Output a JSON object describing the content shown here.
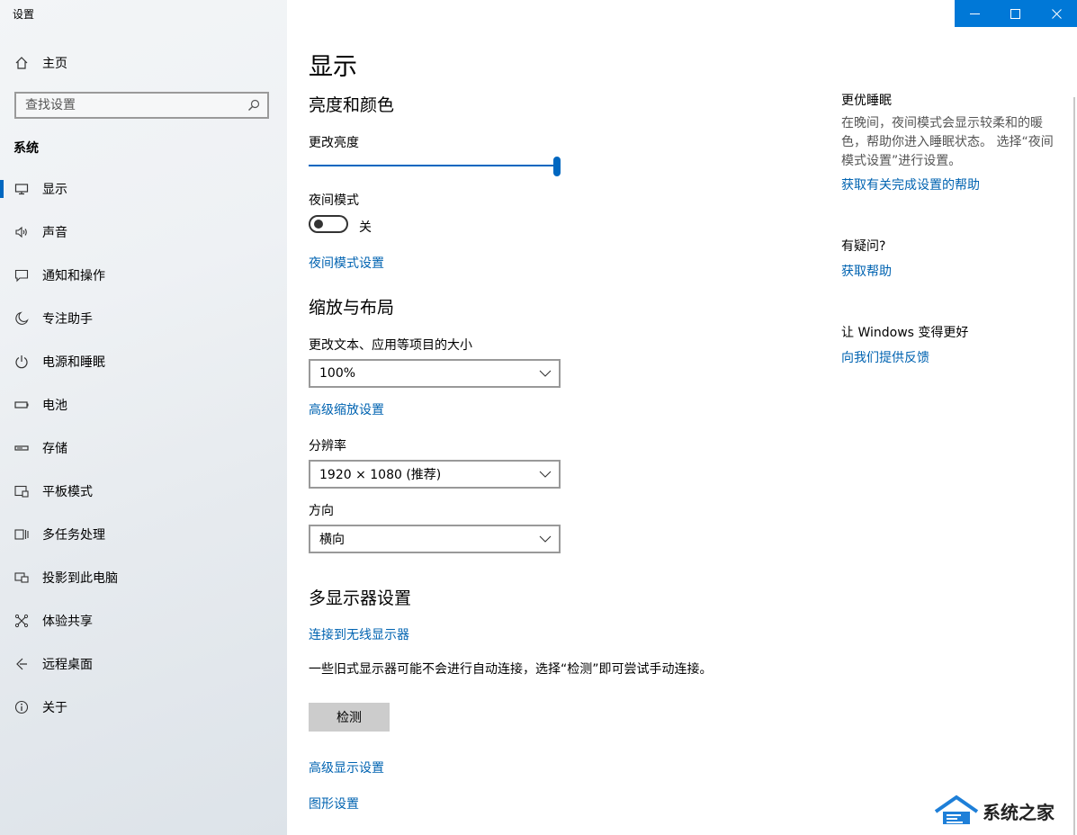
{
  "app": {
    "title": "设置"
  },
  "sidebar": {
    "home_label": "主页",
    "search_placeholder": "查找设置",
    "section_title": "系统",
    "items": [
      {
        "label": "显示",
        "icon": "monitor-icon",
        "selected": true
      },
      {
        "label": "声音",
        "icon": "speaker-icon"
      },
      {
        "label": "通知和操作",
        "icon": "message-icon"
      },
      {
        "label": "专注助手",
        "icon": "moon-icon"
      },
      {
        "label": "电源和睡眠",
        "icon": "power-icon"
      },
      {
        "label": "电池",
        "icon": "battery-icon"
      },
      {
        "label": "存储",
        "icon": "storage-icon"
      },
      {
        "label": "平板模式",
        "icon": "tablet-icon"
      },
      {
        "label": "多任务处理",
        "icon": "multitask-icon"
      },
      {
        "label": "投影到此电脑",
        "icon": "project-icon"
      },
      {
        "label": "体验共享",
        "icon": "share-icon"
      },
      {
        "label": "远程桌面",
        "icon": "remote-icon"
      },
      {
        "label": "关于",
        "icon": "info-icon"
      }
    ]
  },
  "main": {
    "title": "显示",
    "brightness": {
      "heading": "亮度和颜色",
      "brightness_label": "更改亮度",
      "brightness_value": 100,
      "night_mode_label": "夜间模式",
      "night_mode_state": "关",
      "night_mode_settings_link": "夜间模式设置"
    },
    "scale": {
      "heading": "缩放与布局",
      "size_label": "更改文本、应用等项目的大小",
      "size_value": "100%",
      "advanced_scale_link": "高级缩放设置",
      "resolution_label": "分辨率",
      "resolution_value": "1920 × 1080 (推荐)",
      "orientation_label": "方向",
      "orientation_value": "横向"
    },
    "multi_display": {
      "heading": "多显示器设置",
      "connect_link": "连接到无线显示器",
      "description": "一些旧式显示器可能不会进行自动连接，选择“检测”即可尝试手动连接。",
      "detect_button": "检测",
      "advanced_display_link": "高级显示设置",
      "graphics_link": "图形设置"
    }
  },
  "right": {
    "sleep_title": "更优睡眠",
    "sleep_text": "在晚间，夜间模式会显示较柔和的暖色，帮助你进入睡眠状态。 选择“夜间模式设置”进行设置。",
    "sleep_link": "获取有关完成设置的帮助",
    "question_title": "有疑问?",
    "question_link": "获取帮助",
    "improve_title": "让 Windows 变得更好",
    "improve_link": "向我们提供反馈"
  },
  "watermark": {
    "text": "系统之家"
  },
  "colors": {
    "accent": "#0067c0",
    "link": "#0063b1",
    "titlebar": "#0078d7"
  }
}
